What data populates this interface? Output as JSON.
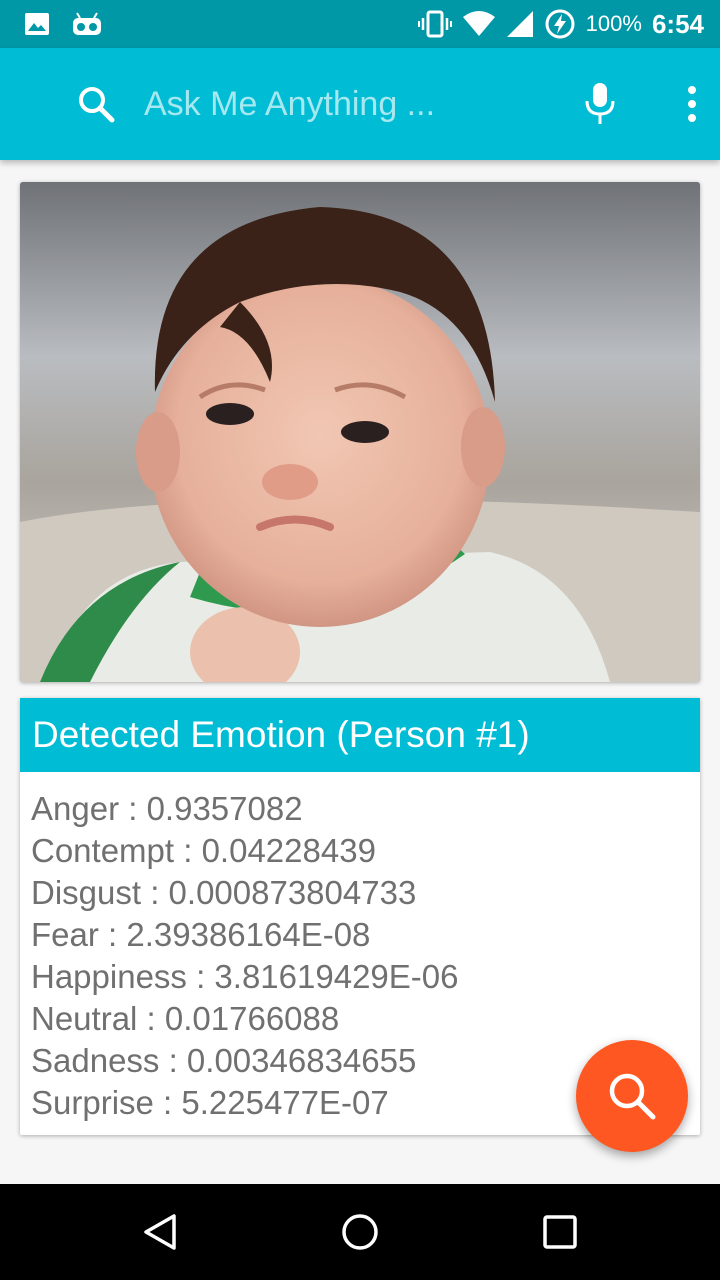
{
  "status_bar": {
    "battery_percent": "100%",
    "time": "6:54",
    "icons": [
      "image-notification-icon",
      "android-robot-icon",
      "vibrate-icon",
      "wifi-icon",
      "cell-signal-icon",
      "battery-charging-icon"
    ]
  },
  "app_bar": {
    "search_placeholder": "Ask Me Anything ...",
    "icons": [
      "search-icon",
      "mic-icon",
      "more-vert-icon"
    ]
  },
  "photo": {
    "subject": "baby-photo"
  },
  "result": {
    "title": "Detected Emotion (Person #1)",
    "emotions": [
      {
        "label": "Anger : 0.9357082"
      },
      {
        "label": "Contempt : 0.04228439"
      },
      {
        "label": "Disgust : 0.000873804733"
      },
      {
        "label": "Fear : 2.39386164E-08"
      },
      {
        "label": "Happiness : 3.81619429E-06"
      },
      {
        "label": "Neutral : 0.01766088"
      },
      {
        "label": "Sadness : 0.00346834655"
      },
      {
        "label": "Surprise : 5.225477E-07"
      }
    ]
  },
  "fab": {
    "icon": "search-icon"
  },
  "nav_bar": {
    "icons": [
      "back-icon",
      "home-icon",
      "recent-apps-icon"
    ]
  },
  "colors": {
    "status_bar": "#0097a7",
    "app_bar": "#00bcd4",
    "card_header": "#00bcd4",
    "fab": "#ff5722",
    "text": "#707070"
  }
}
